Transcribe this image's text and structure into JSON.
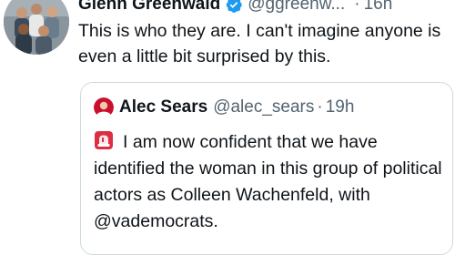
{
  "tweet": {
    "author_name": "Glenn Greenwald",
    "author_handle": "@ggreenw...",
    "separator": "·",
    "time": "16h",
    "text": "This is who they are. I can't imagine anyone is even a little bit surprised by this.",
    "verified_icon": "verified-badge-icon"
  },
  "quoted_tweet": {
    "author_name": "Alec Sears",
    "author_handle": "@alec_sears",
    "separator": "·",
    "time": "19h",
    "emoji_icon": "police-siren-icon",
    "text": "I am now confident that we have identified the woman in this group of political actors as Colleen Wachenfeld, with @vademocrats."
  },
  "colors": {
    "text_primary": "#0f1419",
    "text_secondary": "#536471",
    "border": "#cfd9de",
    "verified_blue": "#1d9bf0"
  }
}
